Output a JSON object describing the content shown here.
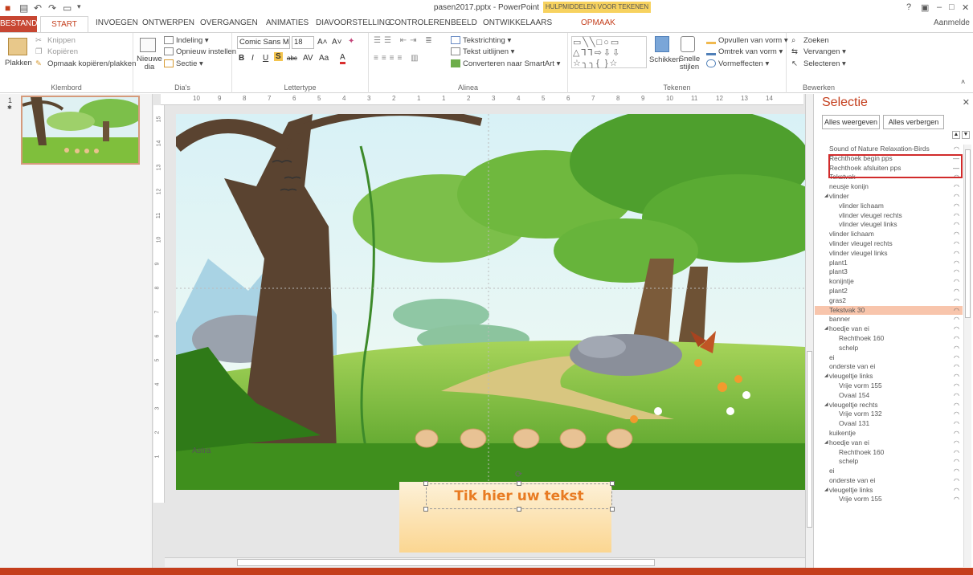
{
  "window": {
    "title": "pasen2017.pptx - PowerPoint",
    "context_title": "HULPMIDDELEN VOOR TEKENEN",
    "help": "?",
    "min": "–",
    "max": "□",
    "close": "✕",
    "signin": "Aanmelde"
  },
  "tabs": {
    "file": "BESTAND",
    "start": "START",
    "items": [
      "INVOEGEN",
      "ONTWERPEN",
      "OVERGANGEN",
      "ANIMATIES",
      "DIAVOORSTELLING",
      "CONTROLEREN",
      "BEELD",
      "ONTWIKKELAARS"
    ],
    "opmaak": "OPMAAK"
  },
  "ribbon": {
    "clipboard": {
      "paste": "Plakken",
      "cut": "Knippen",
      "copy": "Kopiëren",
      "format_painter": "Opmaak kopiëren/plakken",
      "label": "Klembord"
    },
    "slides": {
      "new_slide": "Nieuwe dia",
      "layout": "Indeling",
      "reset": "Opnieuw instellen",
      "section": "Sectie",
      "label": "Dia's"
    },
    "font": {
      "name": "Comic Sans MS",
      "size": "18",
      "label": "Lettertype"
    },
    "paragraph": {
      "text_direction": "Tekstrichting",
      "align_text": "Tekst uitlijnen",
      "smartart": "Converteren naar SmartArt",
      "label": "Alinea"
    },
    "drawing": {
      "arrange": "Schikken",
      "quick_styles": "Snelle stijlen",
      "fill": "Opvullen van vorm",
      "outline": "Omtrek van vorm",
      "effects": "Vormeffecten",
      "label": "Tekenen"
    },
    "editing": {
      "find": "Zoeken",
      "replace": "Vervangen",
      "select": "Selecteren",
      "label": "Bewerken"
    }
  },
  "ruler": {
    "h_ticks": [
      "10",
      "9",
      "8",
      "7",
      "6",
      "5",
      "4",
      "3",
      "2",
      "1",
      "1",
      "2",
      "3",
      "4",
      "5",
      "6",
      "7",
      "8",
      "9",
      "10",
      "11",
      "12",
      "13",
      "14"
    ],
    "v_ticks": [
      "15",
      "14",
      "13",
      "12",
      "11",
      "10",
      "9",
      "8",
      "7",
      "6",
      "5",
      "4",
      "3",
      "2",
      "1"
    ]
  },
  "thumbnail": {
    "number": "1",
    "star": "✱"
  },
  "slide": {
    "watermark": "Astra",
    "textbox": "Tik hier uw tekst"
  },
  "selection_pane": {
    "title": "Selectie",
    "show_all": "Alles weergeven",
    "hide_all": "Alles verbergen",
    "close": "✕",
    "items": [
      {
        "label": "Sound of Nature Relaxation-Birds",
        "level": 0,
        "state": "shown"
      },
      {
        "label": "Rechthoek begin pps",
        "level": 0,
        "state": "hidden"
      },
      {
        "label": "Rechthoek afsluiten pps",
        "level": 0,
        "state": "hidden"
      },
      {
        "label": "Tekstvak",
        "level": 0,
        "state": "shown"
      },
      {
        "label": "neusje konijn",
        "level": 0,
        "state": "shown"
      },
      {
        "label": "vlinder",
        "level": 0,
        "group": true,
        "state": "shown"
      },
      {
        "label": "vlinder lichaam",
        "level": 1,
        "state": "shown"
      },
      {
        "label": "vlinder vleugel rechts",
        "level": 1,
        "state": "shown"
      },
      {
        "label": "vlinder vleugel links",
        "level": 1,
        "state": "shown"
      },
      {
        "label": "vlinder lichaam",
        "level": 0,
        "state": "shown"
      },
      {
        "label": "vlinder vleugel rechts",
        "level": 0,
        "state": "shown"
      },
      {
        "label": "vlinder vleugel links",
        "level": 0,
        "state": "shown"
      },
      {
        "label": "plant1",
        "level": 0,
        "state": "shown"
      },
      {
        "label": "plant3",
        "level": 0,
        "state": "shown"
      },
      {
        "label": "konijntje",
        "level": 0,
        "state": "shown"
      },
      {
        "label": "plant2",
        "level": 0,
        "state": "shown"
      },
      {
        "label": "gras2",
        "level": 0,
        "state": "shown"
      },
      {
        "label": "Tekstvak 30",
        "level": 0,
        "state": "shown",
        "selected": true
      },
      {
        "label": "banner",
        "level": 0,
        "state": "shown"
      },
      {
        "label": "hoedje van ei",
        "level": 0,
        "group": true,
        "state": "shown"
      },
      {
        "label": "Rechthoek 160",
        "level": 1,
        "state": "shown"
      },
      {
        "label": "schelp",
        "level": 1,
        "state": "shown"
      },
      {
        "label": "ei",
        "level": 0,
        "state": "shown"
      },
      {
        "label": "onderste van ei",
        "level": 0,
        "state": "shown"
      },
      {
        "label": "vleugeltje links",
        "level": 0,
        "group": true,
        "state": "shown"
      },
      {
        "label": "Vrije vorm 155",
        "level": 1,
        "state": "shown"
      },
      {
        "label": "Ovaal 154",
        "level": 1,
        "state": "shown"
      },
      {
        "label": "vleugeltje rechts",
        "level": 0,
        "group": true,
        "state": "shown"
      },
      {
        "label": "Vrije vorm 132",
        "level": 1,
        "state": "shown"
      },
      {
        "label": "Ovaal 131",
        "level": 1,
        "state": "shown"
      },
      {
        "label": "kuikentje",
        "level": 0,
        "state": "shown"
      },
      {
        "label": "hoedje van ei",
        "level": 0,
        "group": true,
        "state": "shown"
      },
      {
        "label": "Rechthoek 160",
        "level": 1,
        "state": "shown"
      },
      {
        "label": "schelp",
        "level": 1,
        "state": "shown"
      },
      {
        "label": "ei",
        "level": 0,
        "state": "shown"
      },
      {
        "label": "onderste van ei",
        "level": 0,
        "state": "shown"
      },
      {
        "label": "vleugeltje links",
        "level": 0,
        "group": true,
        "state": "shown"
      },
      {
        "label": "Vrije vorm 155",
        "level": 1,
        "state": "shown"
      }
    ]
  },
  "colors": {
    "accent": "#c43e1c",
    "file_tab": "#c74632",
    "context_tab": "#f7d25f",
    "highlight_row": "#f8c5ac",
    "annotation": "#d12b2b",
    "textbox_text": "#e87b22"
  }
}
